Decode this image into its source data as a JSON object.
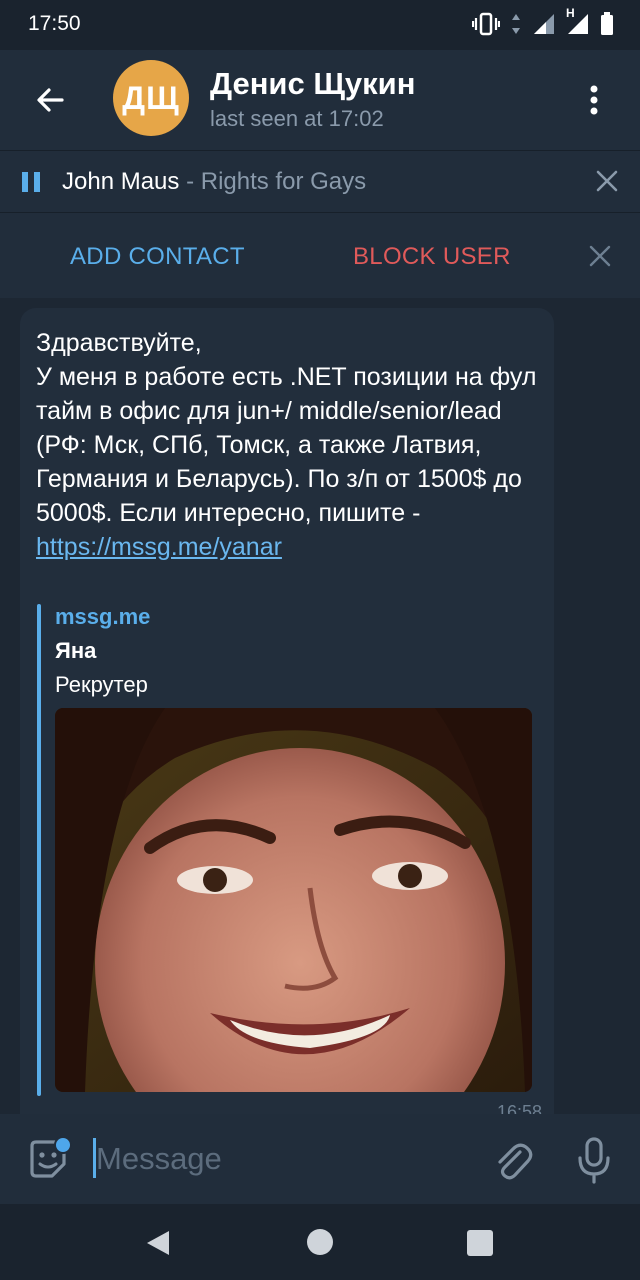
{
  "status_bar": {
    "time": "17:50",
    "icons": [
      "vibrate-icon",
      "data-arrows-icon",
      "signal-icon",
      "signal-h-icon",
      "battery-icon"
    ],
    "network_label": "H"
  },
  "header": {
    "back_icon": "arrow-left-icon",
    "avatar_initials": "ДЩ",
    "avatar_color": "#e6a648",
    "title": "Денис Щукин",
    "subtitle": "last seen at 17:02",
    "menu_icon": "more-vertical-icon"
  },
  "player": {
    "artist": "John Maus",
    "separator": " - ",
    "song": "Rights for Gays",
    "close_icon": "close-icon"
  },
  "actions": {
    "add_contact": "ADD CONTACT",
    "block_user": "BLOCK USER",
    "close_icon": "close-icon"
  },
  "message": {
    "text": "Здравствуйте,\nУ меня в работе есть .NET позиции на фул тайм в офис для jun+/ middle/senior/lead (РФ: Мск, СПб, Томск, а также Латвия, Германия и Беларусь). По з/п от 1500$ до 5000$. Если интересно, пишите - ",
    "link": "https://mssg.me/yanar",
    "preview": {
      "site": "mssg.me",
      "title": "Яна",
      "description": "Рекрутер",
      "image": "profile-photo"
    },
    "time": "16:58"
  },
  "composer": {
    "placeholder": "Message",
    "emoji_icon": "sticker-emoji-icon",
    "attach_icon": "paperclip-icon",
    "mic_icon": "microphone-icon"
  },
  "nav_bar": {
    "back_icon": "nav-back-icon",
    "home_icon": "nav-home-icon",
    "recent_icon": "nav-recents-icon"
  },
  "colors": {
    "accent": "#5aaeea",
    "danger": "#e05a5a",
    "background": "#1d2733",
    "bar": "#212d3b"
  }
}
